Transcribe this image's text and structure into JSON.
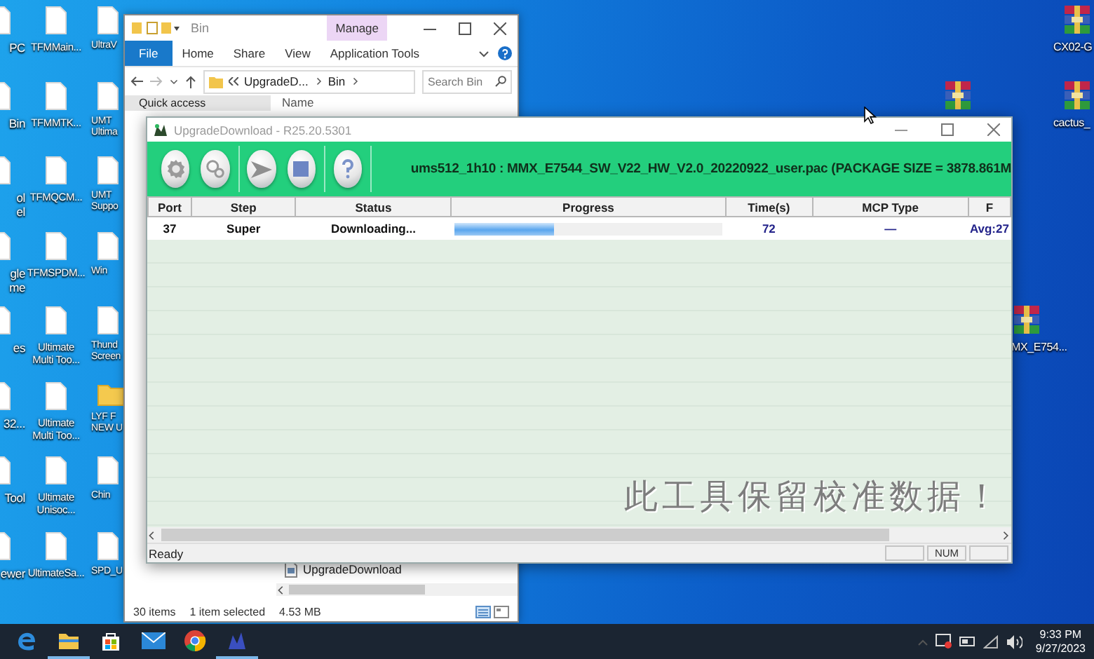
{
  "desktop": {
    "left_columns": [
      [
        {
          "kind": "document",
          "lines": [
            "PC"
          ]
        },
        {
          "kind": "document",
          "lines": [
            "Bin"
          ]
        },
        {
          "kind": "document",
          "lines": [
            "ol",
            "el"
          ]
        },
        {
          "kind": "document",
          "lines": [
            "gle",
            "me"
          ]
        },
        {
          "kind": "document",
          "lines": [
            "es"
          ]
        },
        {
          "kind": "document",
          "lines": [
            "32..."
          ]
        },
        {
          "kind": "document",
          "lines": [
            "Tool"
          ]
        },
        {
          "kind": "document",
          "lines": [
            "ewer"
          ]
        }
      ],
      [
        {
          "kind": "document",
          "lines": [
            "TFMMain..."
          ]
        },
        {
          "kind": "document",
          "lines": [
            "TFMMTK..."
          ]
        },
        {
          "kind": "document",
          "lines": [
            "TFMQCM..."
          ]
        },
        {
          "kind": "document",
          "lines": [
            "TFMSPDM..."
          ]
        },
        {
          "kind": "document",
          "lines": [
            "Ultimate",
            "Multi Too..."
          ]
        },
        {
          "kind": "document",
          "lines": [
            "Ultimate",
            "Multi Too..."
          ]
        },
        {
          "kind": "document",
          "lines": [
            "Ultimate",
            "Unisoc..."
          ]
        },
        {
          "kind": "document",
          "lines": [
            "UltimateSa..."
          ]
        }
      ],
      [
        {
          "kind": "document",
          "lines": [
            "UltraV"
          ]
        },
        {
          "kind": "document",
          "lines": [
            "UMT",
            "Ultima"
          ]
        },
        {
          "kind": "document",
          "lines": [
            "UMT",
            "Suppo"
          ]
        },
        {
          "kind": "document",
          "lines": [
            "Win"
          ]
        },
        {
          "kind": "document",
          "lines": [
            "Thund",
            "Screen"
          ]
        },
        {
          "kind": "folder",
          "lines": [
            "LYF F",
            "NEW U"
          ]
        },
        {
          "kind": "document",
          "lines": [
            "Chin"
          ]
        },
        {
          "kind": "document",
          "lines": [
            "SPD_U"
          ]
        }
      ]
    ],
    "right_icons": [
      {
        "kind": "archive",
        "lines": [
          "CX02-G"
        ]
      },
      {
        "kind": "archive"
      },
      {
        "kind": "archive",
        "lines": [
          "cactus_"
        ]
      },
      {
        "kind": "archive",
        "lines": [
          "MX_E754..."
        ]
      }
    ]
  },
  "explorer": {
    "title": "Bin",
    "context_tab": "Manage",
    "ribbon_tabs": [
      {
        "label": "File",
        "kind": "menu"
      },
      {
        "label": "Home",
        "kind": "tab"
      },
      {
        "label": "Share",
        "kind": "tab"
      },
      {
        "label": "View",
        "kind": "tab"
      },
      {
        "label": "Application Tools",
        "kind": "tab"
      }
    ],
    "breadcrumb": [
      "UpgradeD...",
      "Bin"
    ],
    "search": {
      "placeholder": "Search Bin"
    },
    "nav_item": "Quick access",
    "column_header": "Name",
    "file": "UpgradeDownload",
    "status_bar": [
      "30 items",
      "1 item selected",
      "4.53 MB"
    ]
  },
  "upgrade_download": {
    "title": "UpgradeDownload - R25.20.5301",
    "package_info": "ums512_1h10 : MMX_E7544_SW_V22_HW_V2.0_20220922_user.pac (PACKAGE SIZE = 3878.861M",
    "columns": [
      "Port",
      "Step",
      "Status",
      "Progress",
      "Time(s)",
      "MCP Type",
      "F"
    ],
    "rows": [
      {
        "port": "37",
        "step": "Super",
        "status": "Downloading...",
        "level": 0.37,
        "time": "72",
        "mcp_type": "—",
        "column_7": "Avg:27"
      }
    ],
    "banner_text": "此工具保留校准数据！",
    "status_text": "Ready",
    "indicator": "NUM"
  },
  "taskbar": {
    "apps": [
      {
        "kind": "edge",
        "running": false
      },
      {
        "kind": "folder",
        "running": true
      },
      {
        "kind": "store",
        "running": false
      },
      {
        "kind": "mail",
        "running": false
      },
      {
        "kind": "chrome",
        "running": false
      },
      {
        "kind": "tool",
        "running": true
      }
    ],
    "time": "9:33 PM",
    "date": "9/27/2023"
  }
}
